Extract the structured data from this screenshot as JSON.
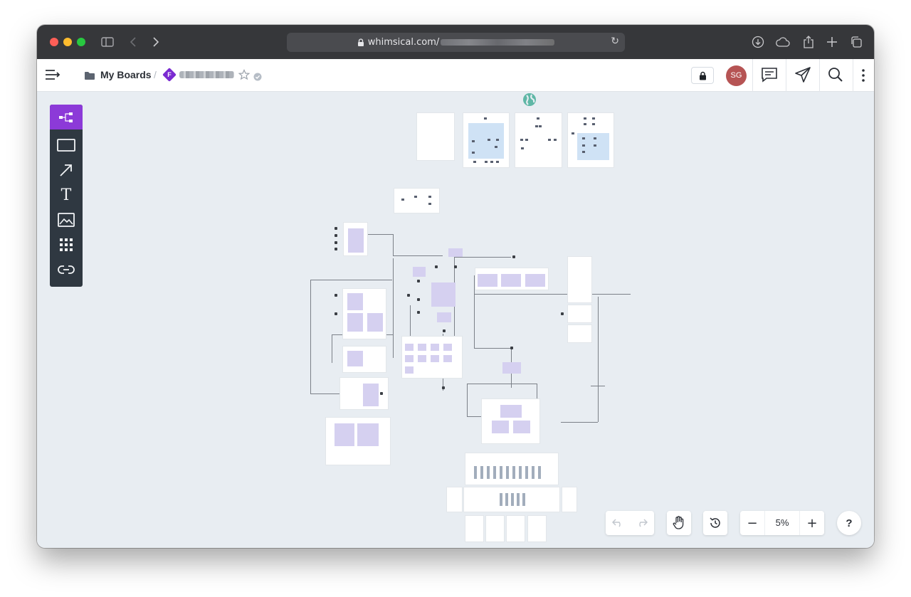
{
  "browser": {
    "url_prefix": "whimsical.com/",
    "reload_glyph": "↻",
    "icons": [
      "sidebar-icon",
      "back-icon",
      "forward-icon",
      "download-icon",
      "cloud-icon",
      "share-icon",
      "new-tab-icon",
      "tabs-icon"
    ]
  },
  "header": {
    "breadcrumb_root": "My Boards",
    "breadcrumb_sep": "/",
    "board_badge_letter": "F",
    "avatar_initials": "SG",
    "icons": [
      "menu-collapse-icon",
      "folder-icon",
      "star-icon",
      "verified-icon",
      "lock-icon",
      "comment-icon",
      "send-icon",
      "search-icon",
      "more-vertical-icon"
    ]
  },
  "toolbar": {
    "tools": [
      "flowchart-tool",
      "rectangle-tool",
      "arrow-tool",
      "text-tool",
      "image-tool",
      "grid-tool",
      "link-tool"
    ],
    "active_tool": "flowchart-tool",
    "text_tool_glyph": "T"
  },
  "controls": {
    "zoom": "5%",
    "zoom_out": "−",
    "zoom_in": "+",
    "help": "?"
  },
  "colors": {
    "accent": "#8c3ad8",
    "toolbar_bg": "#2f3841",
    "canvas_bg": "#e8edf2",
    "avatar": "#b65454",
    "panel_purple": "#d5d0f0",
    "panel_blue": "#cfe2f5"
  }
}
